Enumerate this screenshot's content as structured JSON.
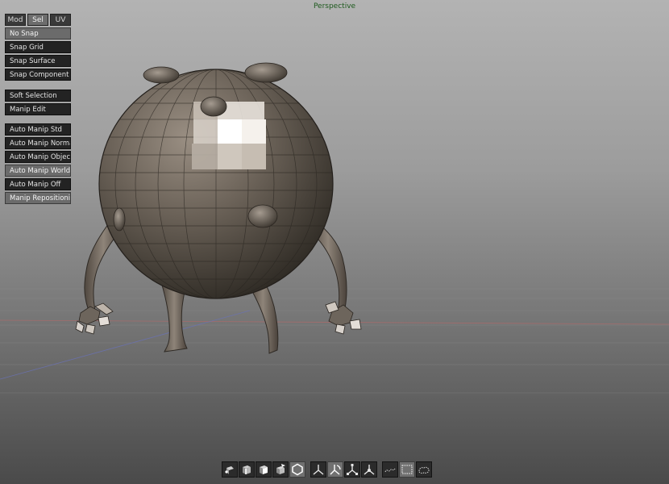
{
  "viewport": {
    "label": "Perspective"
  },
  "mode_tabs": [
    {
      "label": "Mod",
      "active": false
    },
    {
      "label": "Sel",
      "active": true
    },
    {
      "label": "UV",
      "active": false
    }
  ],
  "snap_menu": [
    {
      "label": "No Snap",
      "active": true
    },
    {
      "label": "Snap Grid",
      "active": false
    },
    {
      "label": "Snap Surface",
      "active": false
    },
    {
      "label": "Snap Component",
      "active": false
    }
  ],
  "edit_menu": [
    {
      "label": "Soft Selection",
      "active": false
    },
    {
      "label": "Manip Edit",
      "active": false
    }
  ],
  "manip_menu": [
    {
      "label": "Auto Manip Std",
      "active": false
    },
    {
      "label": "Auto Manip Normal",
      "active": false
    },
    {
      "label": "Auto Manip Object",
      "active": false
    },
    {
      "label": "Auto Manip World",
      "active": true
    },
    {
      "label": "Auto Manip Off",
      "active": false
    },
    {
      "label": "Manip Repositioning",
      "active": true
    }
  ],
  "toolbar": {
    "selection_modes": [
      {
        "icon": "vertex-mode-icon",
        "active": false
      },
      {
        "icon": "edge-mode-icon",
        "active": false
      },
      {
        "icon": "face-mode-icon",
        "active": false
      },
      {
        "icon": "uv-mode-icon",
        "active": false
      },
      {
        "icon": "object-mode-icon",
        "active": true
      }
    ],
    "manipulators": [
      {
        "icon": "move-manip-icon",
        "active": false
      },
      {
        "icon": "rotate-manip-icon",
        "active": true
      },
      {
        "icon": "scale-manip-icon",
        "active": false
      },
      {
        "icon": "universal-manip-icon",
        "active": false
      }
    ],
    "select_tools": [
      {
        "icon": "lasso-select-icon",
        "active": false
      },
      {
        "icon": "marquee-select-icon",
        "active": true
      },
      {
        "icon": "paint-select-icon",
        "active": false
      }
    ]
  }
}
